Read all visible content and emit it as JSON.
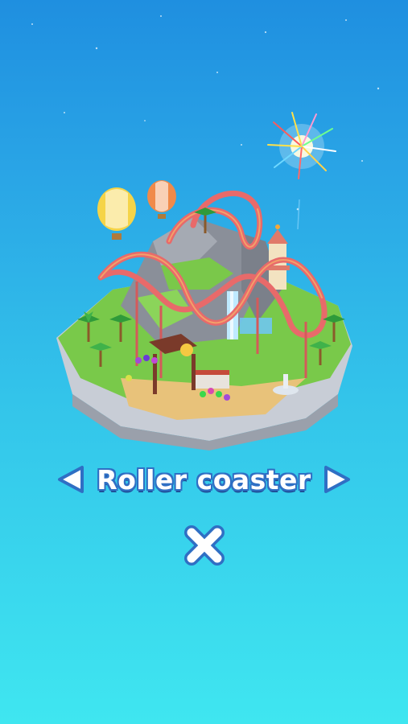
{
  "attraction": {
    "name": "Roller coaster"
  },
  "icons": {
    "prev": "chevron-left-icon",
    "next": "chevron-right-icon",
    "close": "close-icon"
  },
  "colors": {
    "sky_top": "#1f8fe0",
    "sky_bottom": "#3fe6f0",
    "button_fill": "#ffffff",
    "button_outline": "#2f6fc4"
  }
}
